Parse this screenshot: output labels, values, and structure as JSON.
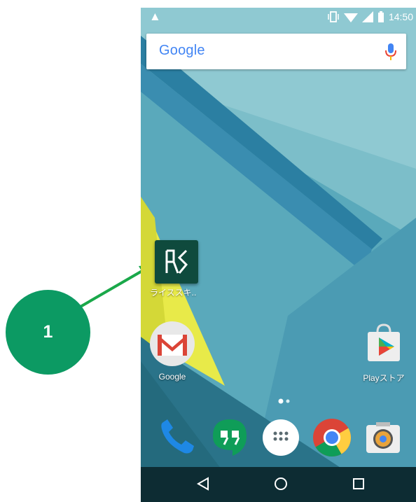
{
  "status_bar": {
    "warning_glyph": "▲",
    "time": "14:50"
  },
  "search": {
    "logo": "Google"
  },
  "home_apps": [
    {
      "label": "ライススキ.."
    },
    {
      "label": "Google"
    },
    {
      "label": "Playストア"
    }
  ],
  "callout": {
    "number": "1"
  },
  "colors": {
    "callout_green": "#0c9a63",
    "arrow_green": "#1aa84a",
    "app_dark_green": "#0f4a3d"
  },
  "icons": [
    "warning-icon",
    "vibrate-icon",
    "wifi-icon",
    "signal-icon",
    "battery-icon",
    "mic-icon",
    "phone-icon",
    "hangouts-icon",
    "app-drawer-icon",
    "chrome-icon",
    "camera-icon",
    "back-icon",
    "home-icon",
    "recents-icon"
  ]
}
